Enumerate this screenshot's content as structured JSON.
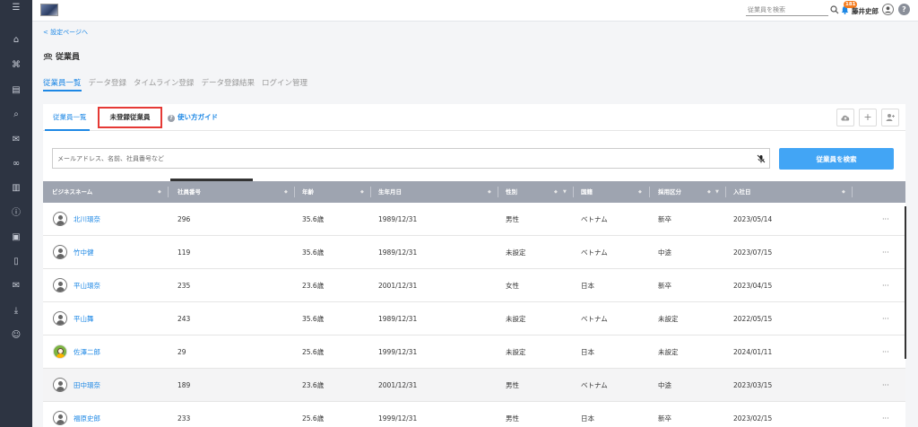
{
  "topbar": {
    "search_placeholder": "従業員を検索",
    "notification_count": "181",
    "user_name": "藤井史郎",
    "help_label": "?"
  },
  "nav_icons": [
    "home-icon",
    "org-chart-icon",
    "document-icon",
    "search-icon",
    "chat-icon",
    "link-icon",
    "bar-chart-icon",
    "info-icon",
    "contact-card-icon",
    "book-icon",
    "mail-icon",
    "download-icon",
    "user-settings-icon"
  ],
  "back_link": "< 設定ページへ",
  "page_title": "従業員",
  "main_tabs": [
    "従業員一覧",
    "データ登録",
    "タイムライン登録",
    "データ登録結果",
    "ログイン管理"
  ],
  "sub_tabs": {
    "list": "従業員一覧",
    "unregistered": "未登録従業員",
    "guide": "使い方ガイド"
  },
  "filter": {
    "placeholder": "メールアドレス、名前、社員番号など",
    "button": "従業員を検索"
  },
  "table": {
    "headers": [
      "ビジネスネーム",
      "社員番号",
      "年齢",
      "生年月日",
      "性別",
      "国籍",
      "採用区分",
      "入社日"
    ],
    "rows": [
      {
        "name": "北川環奈",
        "id": "296",
        "age": "35.6歳",
        "birth": "1989/12/31",
        "gender": "男性",
        "nationality": "ベトナム",
        "hire_type": "新卒",
        "joined": "2023/05/14",
        "avatar": "default"
      },
      {
        "name": "竹中健",
        "id": "119",
        "age": "35.6歳",
        "birth": "1989/12/31",
        "gender": "未設定",
        "nationality": "ベトナム",
        "hire_type": "中途",
        "joined": "2023/07/15",
        "avatar": "default"
      },
      {
        "name": "平山環奈",
        "id": "235",
        "age": "23.6歳",
        "birth": "2001/12/31",
        "gender": "女性",
        "nationality": "日本",
        "hire_type": "新卒",
        "joined": "2023/04/15",
        "avatar": "default"
      },
      {
        "name": "平山舞",
        "id": "243",
        "age": "35.6歳",
        "birth": "1989/12/31",
        "gender": "未設定",
        "nationality": "ベトナム",
        "hire_type": "未設定",
        "joined": "2022/05/15",
        "avatar": "default"
      },
      {
        "name": "佐澤二郎",
        "id": "29",
        "age": "25.6歳",
        "birth": "1999/12/31",
        "gender": "未設定",
        "nationality": "日本",
        "hire_type": "未設定",
        "joined": "2024/01/11",
        "avatar": "photo"
      },
      {
        "name": "田中環奈",
        "id": "189",
        "age": "23.6歳",
        "birth": "2001/12/31",
        "gender": "男性",
        "nationality": "ベトナム",
        "hire_type": "中途",
        "joined": "2023/03/15",
        "avatar": "default"
      },
      {
        "name": "福原史郎",
        "id": "233",
        "age": "25.6歳",
        "birth": "1999/12/31",
        "gender": "男性",
        "nationality": "日本",
        "hire_type": "新卒",
        "joined": "2023/02/15",
        "avatar": "default"
      }
    ],
    "row_menu": "···"
  }
}
